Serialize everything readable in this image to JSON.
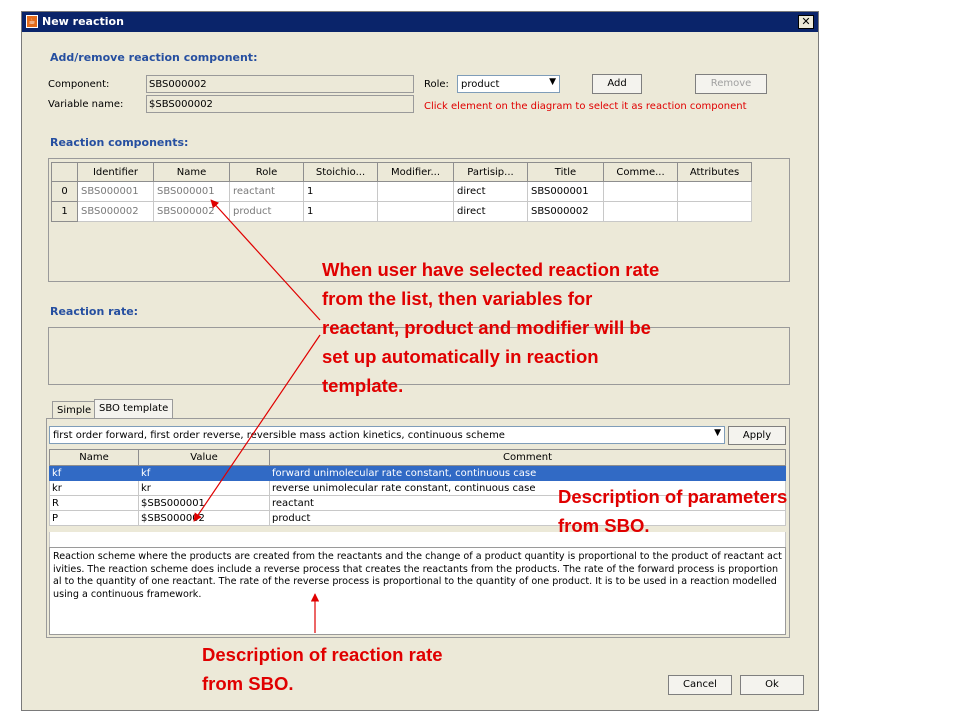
{
  "window": {
    "title": "New reaction",
    "close_label": "✕"
  },
  "add_section": {
    "title": "Add/remove reaction component:",
    "component_label": "Component:",
    "component_value": "SBS000002",
    "variable_label": "Variable name:",
    "variable_value": "$SBS000002",
    "role_label": "Role:",
    "role_value": "product",
    "add_button": "Add",
    "remove_button": "Remove",
    "hint": "Click element on the diagram to select it as reaction component"
  },
  "components": {
    "title": "Reaction components:",
    "columns": [
      "",
      "Identifier",
      "Name",
      "Role",
      "Stoichio...",
      "Modifier...",
      "Partisip...",
      "Title",
      "Comme...",
      "Attributes"
    ],
    "rows": [
      {
        "index": "0",
        "identifier": "SBS000001",
        "name": "SBS000001",
        "role": "reactant",
        "stoich": "1",
        "modifier": "",
        "partisip": "direct",
        "title": "SBS000001",
        "comment": "",
        "attributes": ""
      },
      {
        "index": "1",
        "identifier": "SBS000002",
        "name": "SBS000002",
        "role": "product",
        "stoich": "1",
        "modifier": "",
        "partisip": "direct",
        "title": "SBS000002",
        "comment": "",
        "attributes": ""
      }
    ]
  },
  "rate": {
    "title": "Reaction rate:"
  },
  "tabs": {
    "simple": "Simple",
    "sbo": "SBO template"
  },
  "sbo": {
    "template_value": "first order forward, first order reverse, reversible mass action kinetics, continuous scheme",
    "apply_button": "Apply",
    "columns": [
      "Name",
      "Value",
      "Comment"
    ],
    "rows": [
      {
        "name": "kf",
        "value": "kf",
        "comment": "forward unimolecular rate constant, continuous case"
      },
      {
        "name": "kr",
        "value": "kr",
        "comment": "reverse unimolecular rate constant, continuous case"
      },
      {
        "name": "R",
        "value": "$SBS000001",
        "comment": "reactant"
      },
      {
        "name": "P",
        "value": "$SBS000002",
        "comment": "product"
      }
    ],
    "description_lines": [
      "Reaction scheme where the products are created from the reactants and the change of a product quantity is proportional to the product of reactant act",
      "ivities. The reaction scheme does include a reverse process that creates the reactants from the products. The rate of the forward process is proportion",
      "al to the quantity of one reactant. The rate of the reverse process is proportional to the quantity of one product. It is to be used in a reaction modelled",
      "using a continuous framework."
    ]
  },
  "footer": {
    "cancel": "Cancel",
    "ok": "Ok"
  },
  "annotations": {
    "note1": [
      "When user have selected reaction rate",
      "from the list, then variables for",
      "reactant, product and modifier will be",
      "set up automatically in reaction",
      "template."
    ],
    "note2": [
      "Description of parameters",
      "from SBO."
    ],
    "note3": [
      "Description of reaction rate",
      "from SBO."
    ]
  },
  "colors": {
    "section_title": "#264fa0",
    "annotation": "#e00000",
    "selection": "#316ac5",
    "titlebar": "#0a246a"
  }
}
